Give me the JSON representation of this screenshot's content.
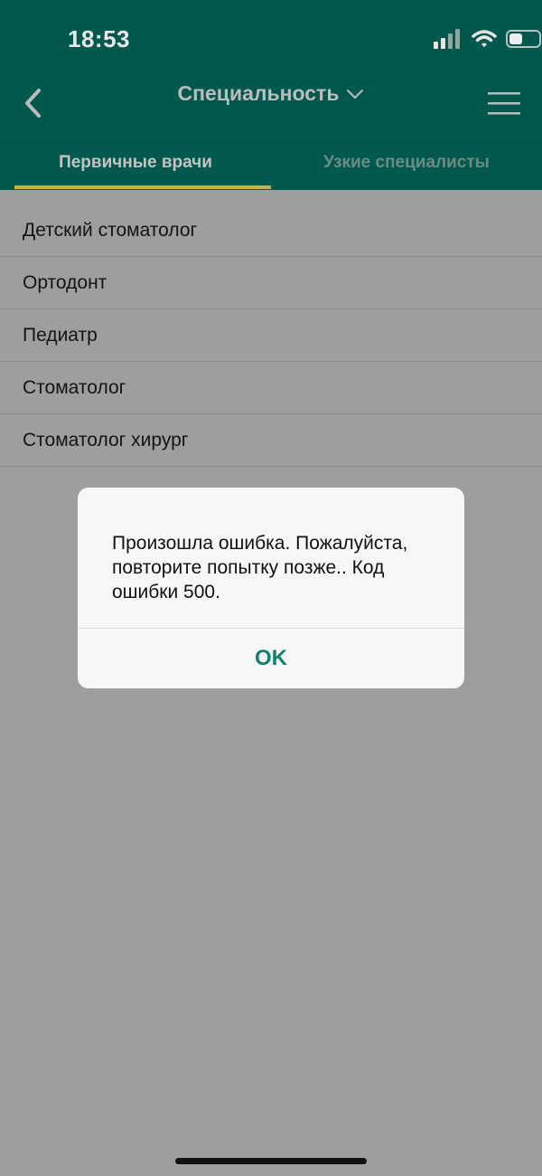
{
  "status_bar": {
    "time": "18:53",
    "icons": [
      "signal-icon",
      "wifi-icon",
      "battery-icon"
    ]
  },
  "nav": {
    "title": "Специальность",
    "icons": {
      "back": "chevron-left-icon",
      "title_dropdown": "chevron-down-icon",
      "menu": "menu-icon"
    }
  },
  "tabs": [
    {
      "label": "Первичные врачи",
      "active": true
    },
    {
      "label": "Узкие специалисты",
      "active": false
    }
  ],
  "specialties": [
    "Детский стоматолог",
    "Ортодонт",
    "Педиатр",
    "Стоматолог",
    "Стоматолог хирург"
  ],
  "dialog": {
    "message": "Произошла ошибка. Пожалуйста, повторите попытку позже.. Код ошибки 500.",
    "ok_label": "OK"
  },
  "colors": {
    "header": "#01584d",
    "tab_underline": "#bdb54d",
    "ok_button": "#147f6f",
    "overlay_background": "#9e9e9e"
  }
}
